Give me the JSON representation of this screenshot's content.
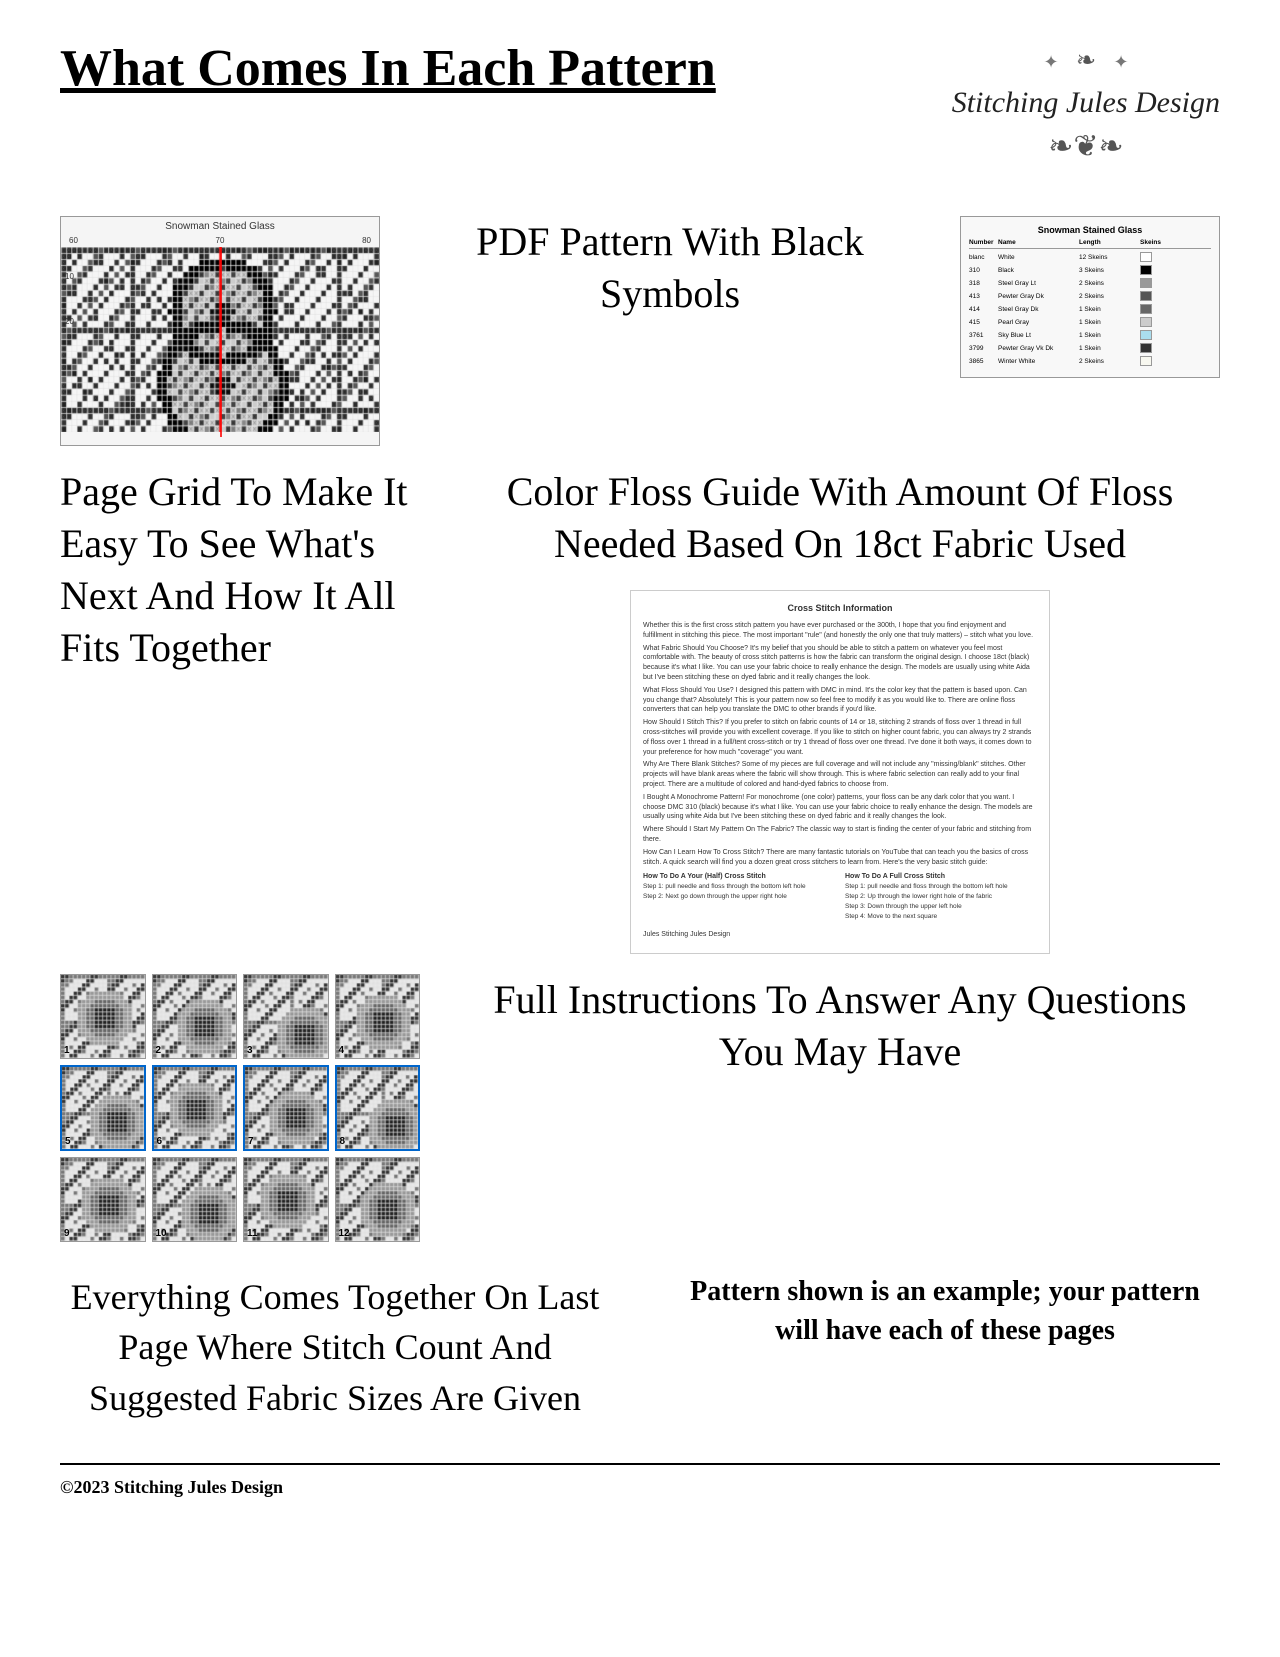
{
  "header": {
    "title": "What Comes In Each Pattern",
    "logo": {
      "line1": "Stitching Jules Design",
      "ornament": "❧❦❧"
    }
  },
  "sections": {
    "pdf_pattern": {
      "label": "PDF Pattern With Black Symbols",
      "pattern_name": "Snowman Stained Glass"
    },
    "floss_guide": {
      "label": "Color Floss Guide With Amount Of Floss Needed Based On 18ct Fabric Used",
      "table_title": "Snowman Stained Glass",
      "columns": [
        "Number",
        "Name",
        "Length",
        "Skeins"
      ],
      "rows": [
        {
          "num": "blanc",
          "name": "White",
          "length": "12 Skeins",
          "color": "#ffffff"
        },
        {
          "num": "310",
          "name": "Black",
          "length": "3 Skeins",
          "color": "#000000"
        },
        {
          "num": "318",
          "name": "Steel Gray Lt",
          "length": "2 Skeins",
          "color": "#999999"
        },
        {
          "num": "413",
          "name": "Pewter Gray Dk",
          "length": "2 Skeins",
          "color": "#555555"
        },
        {
          "num": "414",
          "name": "Steel Gray Dk",
          "length": "1 Skein",
          "color": "#666666"
        },
        {
          "num": "415",
          "name": "Pearl Gray",
          "length": "1 Skein",
          "color": "#cccccc"
        },
        {
          "num": "3761",
          "name": "Sky Blue Lt",
          "length": "1 Skein",
          "color": "#aaddee"
        },
        {
          "num": "3799",
          "name": "Pewter Gray Vk Dk",
          "length": "1 Skein",
          "color": "#333333"
        },
        {
          "num": "3865",
          "name": "Winter White",
          "length": "2 Skeins",
          "color": "#f8f8f0"
        }
      ]
    },
    "page_grid": {
      "label": "Page Grid To Make It Easy To See What's Next And How It All Fits Together"
    },
    "instructions": {
      "label": "Full Instructions To Answer Any Questions You May Have",
      "doc_title": "Cross Stitch Information",
      "paragraphs": [
        "Whether this is the first cross stitch pattern you have ever purchased or the 300th, I hope that you find enjoyment and fulfillment in stitching this piece. The most important \"rule\" (and honestly the only one that truly matters) – stitch what you love.",
        "What Fabric Should You Choose? It's my belief that you should be able to stitch a pattern on whatever you feel most comfortable with. The beauty of cross stitch patterns is how the fabric can transform the original design. I choose 18ct (black) because it's what I like. You can use your fabric choice to really enhance the design. The models are usually using white Aida but I've been stitching these on dyed fabric and it really changes the look.",
        "What Floss Should You Use? I designed this pattern with DMC in mind. It's the color key that the pattern is based upon. Can you change that? Absolutely! This is your pattern now so feel free to modify it as you would like to. There are online floss converters that can help you translate the DMC to other brands if you'd like.",
        "How Should I Stitch This? If you prefer to stitch on fabric counts of 14 or 18, stitching 2 strands of floss over 1 thread in full cross-stitches will provide you with excellent coverage. If you like to stitch on higher count fabric, you can always try 2 strands of floss over 1 thread in a full/tent cross-stitch or try 1 thread of floss over one thread. I've done it both ways, it comes down to your preference for how much \"coverage\" you want.",
        "Why Are There Blank Stitches? Some of my pieces are full coverage and will not include any \"missing/blank\" stitches. Other projects will have blank areas where the fabric will show through. This is where fabric selection can really add to your final project. There are a multitude of colored and hand-dyed fabrics to choose from.",
        "I Bought A Monochrome Pattern! For monochrome (one color) patterns, your floss can be any dark color that you want. I choose DMC 310 (black) because it's what I like. You can use your fabric choice to really enhance the design. The models are usually using white Aida but I've been stitching these on dyed fabric and it really changes the look.",
        "Where Should I Start My Pattern On The Fabric? The classic way to start is finding the center of your fabric and stitching from there.",
        "How Can I Learn How To Cross Stitch? There are many fantastic tutorials on YouTube that can teach you the basics of cross stitch. A quick search will find you a dozen great cross stitchers to learn from. Here's the very basic stitch guide:"
      ],
      "how_to_title": "How To Do A Your (Half) Cross Stitch",
      "how_to_alt_title": "How To Do A Full Cross Stitch",
      "half_steps": [
        "Step 1: pull needle and floss through the bottom left hole",
        "Step 2: Next go down through the upper right hole"
      ],
      "full_steps": [
        "Step 1: pull needle and floss through the bottom left hole",
        "Step 2: Up through the lower right hole of the fabric",
        "Step 3: Down through the upper left hole",
        "Step 4: Move to the next square"
      ],
      "sign_off": "Jules\nStitching Jules Design"
    },
    "thumbnails": {
      "label": "12 page thumbnails showing parts of Snowman Stained Glass pattern",
      "count": 12,
      "numbers": [
        "1",
        "2",
        "3",
        "4",
        "5",
        "6",
        "7",
        "8",
        "9",
        "10",
        "11",
        "12"
      ],
      "highlighted": [
        5,
        6,
        7,
        8
      ]
    },
    "everything": {
      "label": "Everything Comes Together On Last Page Where Stitch Count And Suggested Fabric Sizes Are Given"
    },
    "pattern_shown": {
      "label": "Pattern shown is an example; your pattern will have each of these pages"
    }
  },
  "footer": {
    "copyright": "©2023 Stitching Jules Design"
  },
  "colors": {
    "accent": "#0066cc",
    "text_primary": "#000000",
    "background": "#ffffff"
  }
}
